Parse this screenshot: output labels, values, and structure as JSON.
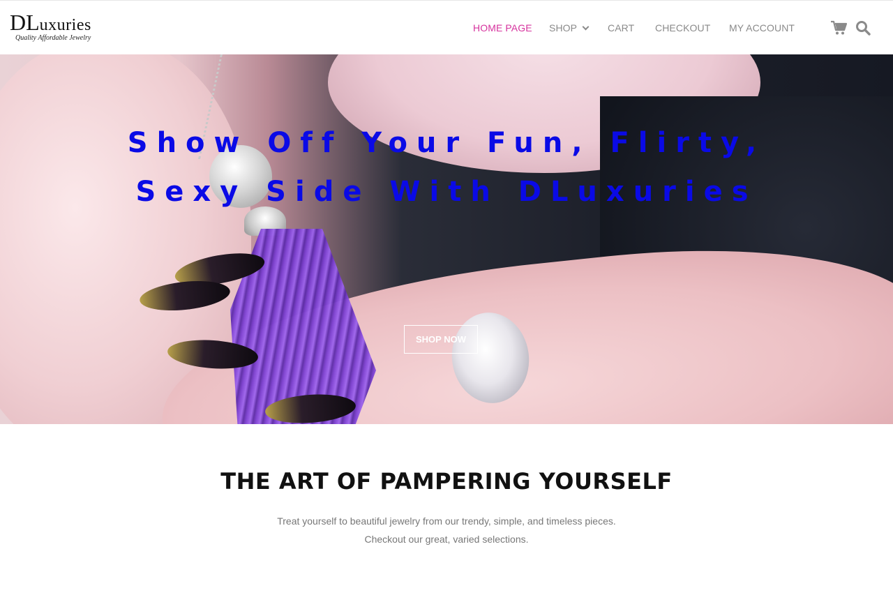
{
  "header": {
    "logo": {
      "brand_first": "DL",
      "brand_rest": "uxuries",
      "tagline": "Quality Affordable Jewelry"
    },
    "nav": {
      "items": [
        {
          "label": "HOME PAGE",
          "active": true
        },
        {
          "label": "SHOP",
          "has_dropdown": true
        },
        {
          "label": "CART"
        },
        {
          "label": "CHECKOUT"
        },
        {
          "label": "MY ACCOUNT"
        }
      ],
      "active_color": "#d6339e",
      "inactive_color": "#8a8a8a"
    },
    "icons": [
      "cart-icon",
      "search-icon"
    ]
  },
  "hero": {
    "title_line1": "Show Off Your Fun, Flirty,",
    "title_line2": "Sexy Side With DLuxuries",
    "title_color": "#0a0ae6",
    "button_label": "SHOP NOW"
  },
  "intro": {
    "heading": "THE ART OF PAMPERING YOURSELF",
    "line1": "Treat yourself to beautiful jewelry from our trendy, simple, and timeless pieces.",
    "line2": "Checkout our great, varied selections."
  }
}
